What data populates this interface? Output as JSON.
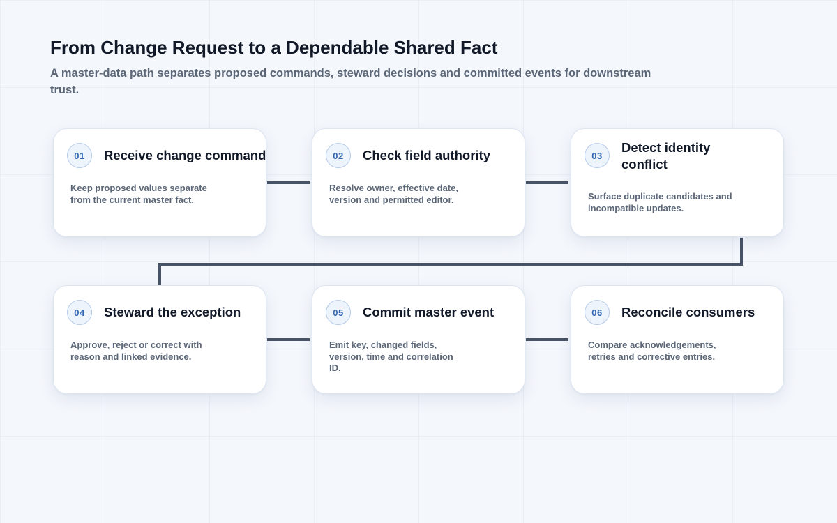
{
  "header": {
    "title": "From Change Request to a Dependable Shared Fact",
    "subtitle": "A master-data path separates proposed commands, steward decisions and committed events for downstream trust."
  },
  "steps": [
    {
      "number": "01",
      "title": "Receive change command",
      "description": "Keep proposed values separate from the current master fact."
    },
    {
      "number": "02",
      "title": "Check field authority",
      "description": "Resolve owner, effective date, version and permitted editor."
    },
    {
      "number": "03",
      "title": "Detect identity conflict",
      "description": "Surface duplicate candidates and incompatible updates."
    },
    {
      "number": "04",
      "title": "Steward the exception",
      "description": "Approve, reject or correct with reason and linked evidence."
    },
    {
      "number": "05",
      "title": "Commit master event",
      "description": "Emit key, changed fields, version, time and correlation ID."
    },
    {
      "number": "06",
      "title": "Reconcile consumers",
      "description": "Compare acknowledgements, retries and corrective entries."
    }
  ],
  "colors": {
    "background": "#f4f7fc",
    "connector": "#475467",
    "badge_text": "#3566b0",
    "title_text": "#111827",
    "body_text": "#5b6677"
  }
}
